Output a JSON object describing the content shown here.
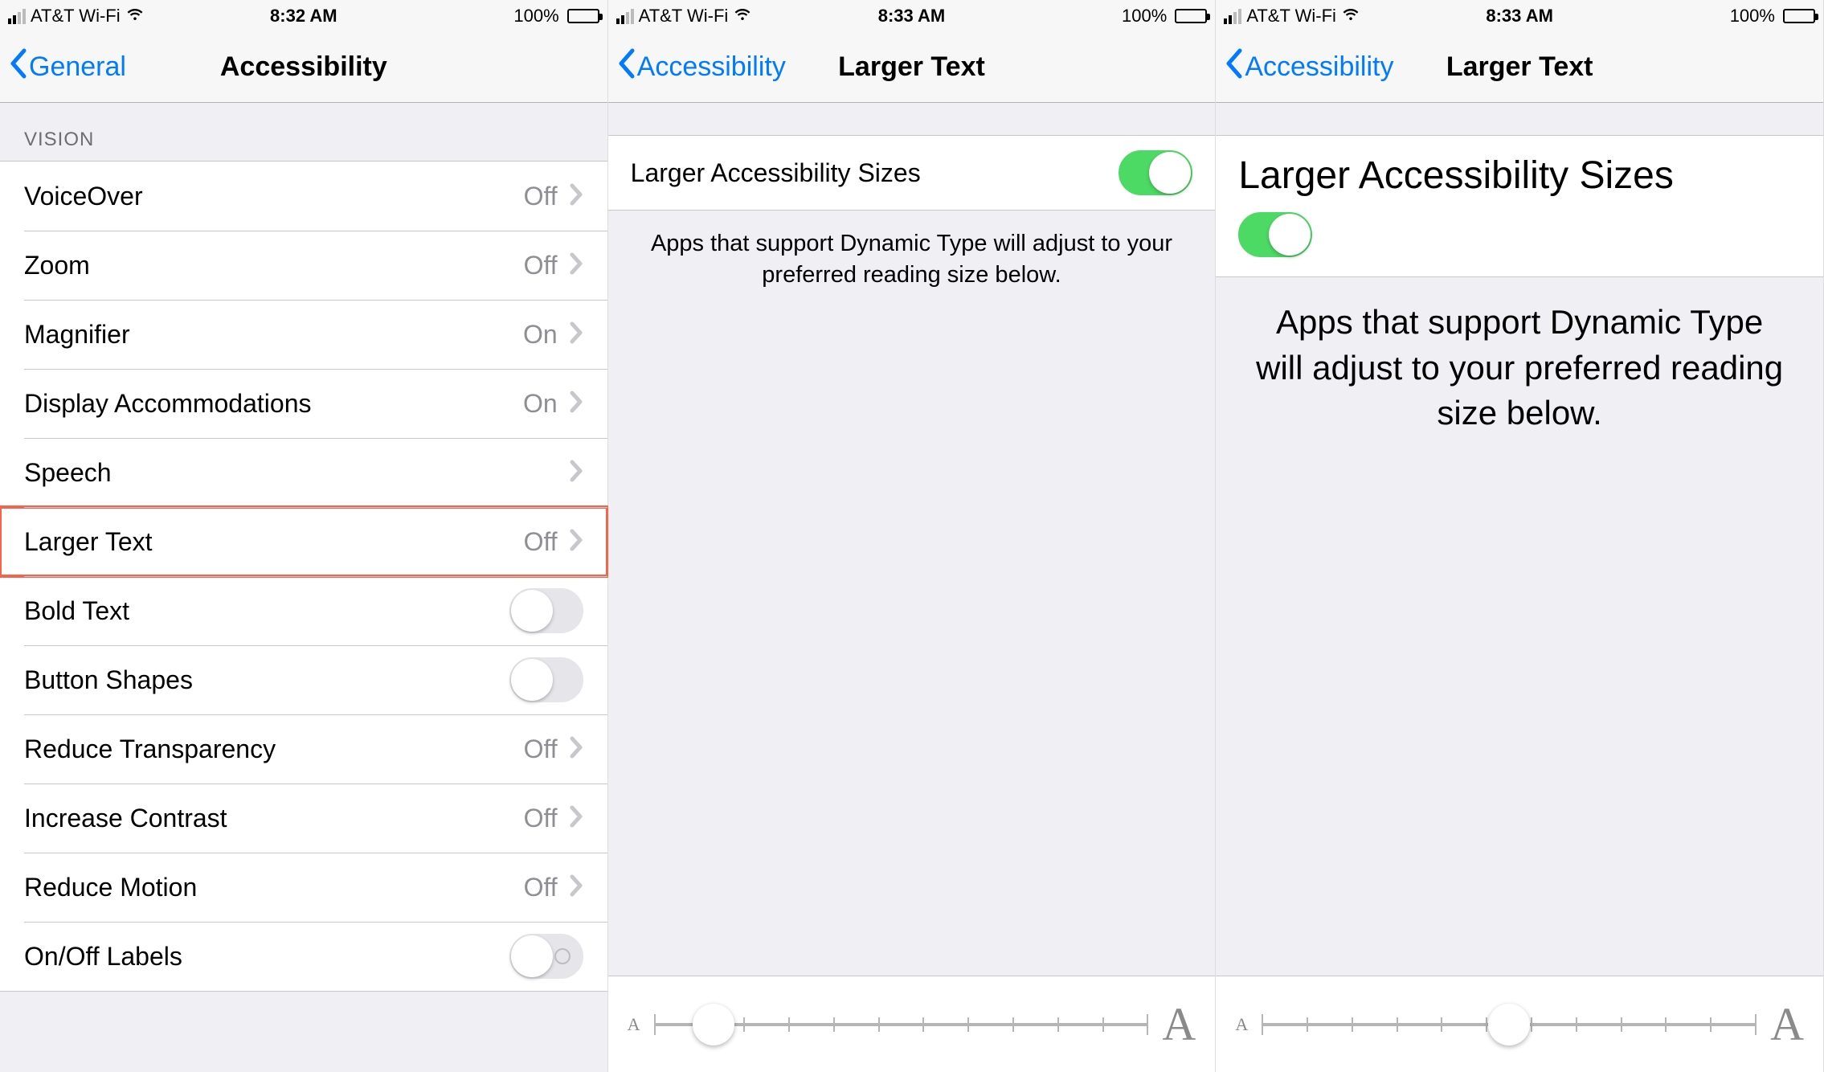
{
  "status": {
    "carrier": "AT&T Wi-Fi",
    "battery_pct": "100%"
  },
  "screens": [
    {
      "status_time": "8:32 AM",
      "back_label": "General",
      "title": "Accessibility",
      "section_header": "Vision",
      "rows": [
        {
          "label": "VoiceOver",
          "value": "Off",
          "type": "nav"
        },
        {
          "label": "Zoom",
          "value": "Off",
          "type": "nav"
        },
        {
          "label": "Magnifier",
          "value": "On",
          "type": "nav"
        },
        {
          "label": "Display Accommodations",
          "value": "On",
          "type": "nav"
        },
        {
          "label": "Speech",
          "value": "",
          "type": "nav"
        },
        {
          "label": "Larger Text",
          "value": "Off",
          "type": "nav",
          "highlight": true
        },
        {
          "label": "Bold Text",
          "type": "toggle",
          "on": false
        },
        {
          "label": "Button Shapes",
          "type": "toggle",
          "on": false
        },
        {
          "label": "Reduce Transparency",
          "value": "Off",
          "type": "nav"
        },
        {
          "label": "Increase Contrast",
          "value": "Off",
          "type": "nav"
        },
        {
          "label": "Reduce Motion",
          "value": "Off",
          "type": "nav"
        },
        {
          "label": "On/Off Labels",
          "type": "toggle",
          "on": false,
          "with_o": true
        }
      ]
    },
    {
      "status_time": "8:33 AM",
      "back_label": "Accessibility",
      "title": "Larger Text",
      "toggle_label": "Larger Accessibility Sizes",
      "toggle_on": true,
      "footer": "Apps that support Dynamic Type will adjust to your preferred reading size below.",
      "slider": {
        "ticks": 12,
        "pos_pct": 12,
        "a_small": "A",
        "a_large": "A"
      }
    },
    {
      "status_time": "8:33 AM",
      "back_label": "Accessibility",
      "title": "Larger Text",
      "toggle_label": "Larger Accessibility Sizes",
      "toggle_on": true,
      "footer": "Apps that support Dynamic Type will adjust to your preferred reading size below.",
      "slider": {
        "ticks": 12,
        "pos_pct": 50,
        "a_small": "A",
        "a_large": "A"
      },
      "large": true
    }
  ]
}
